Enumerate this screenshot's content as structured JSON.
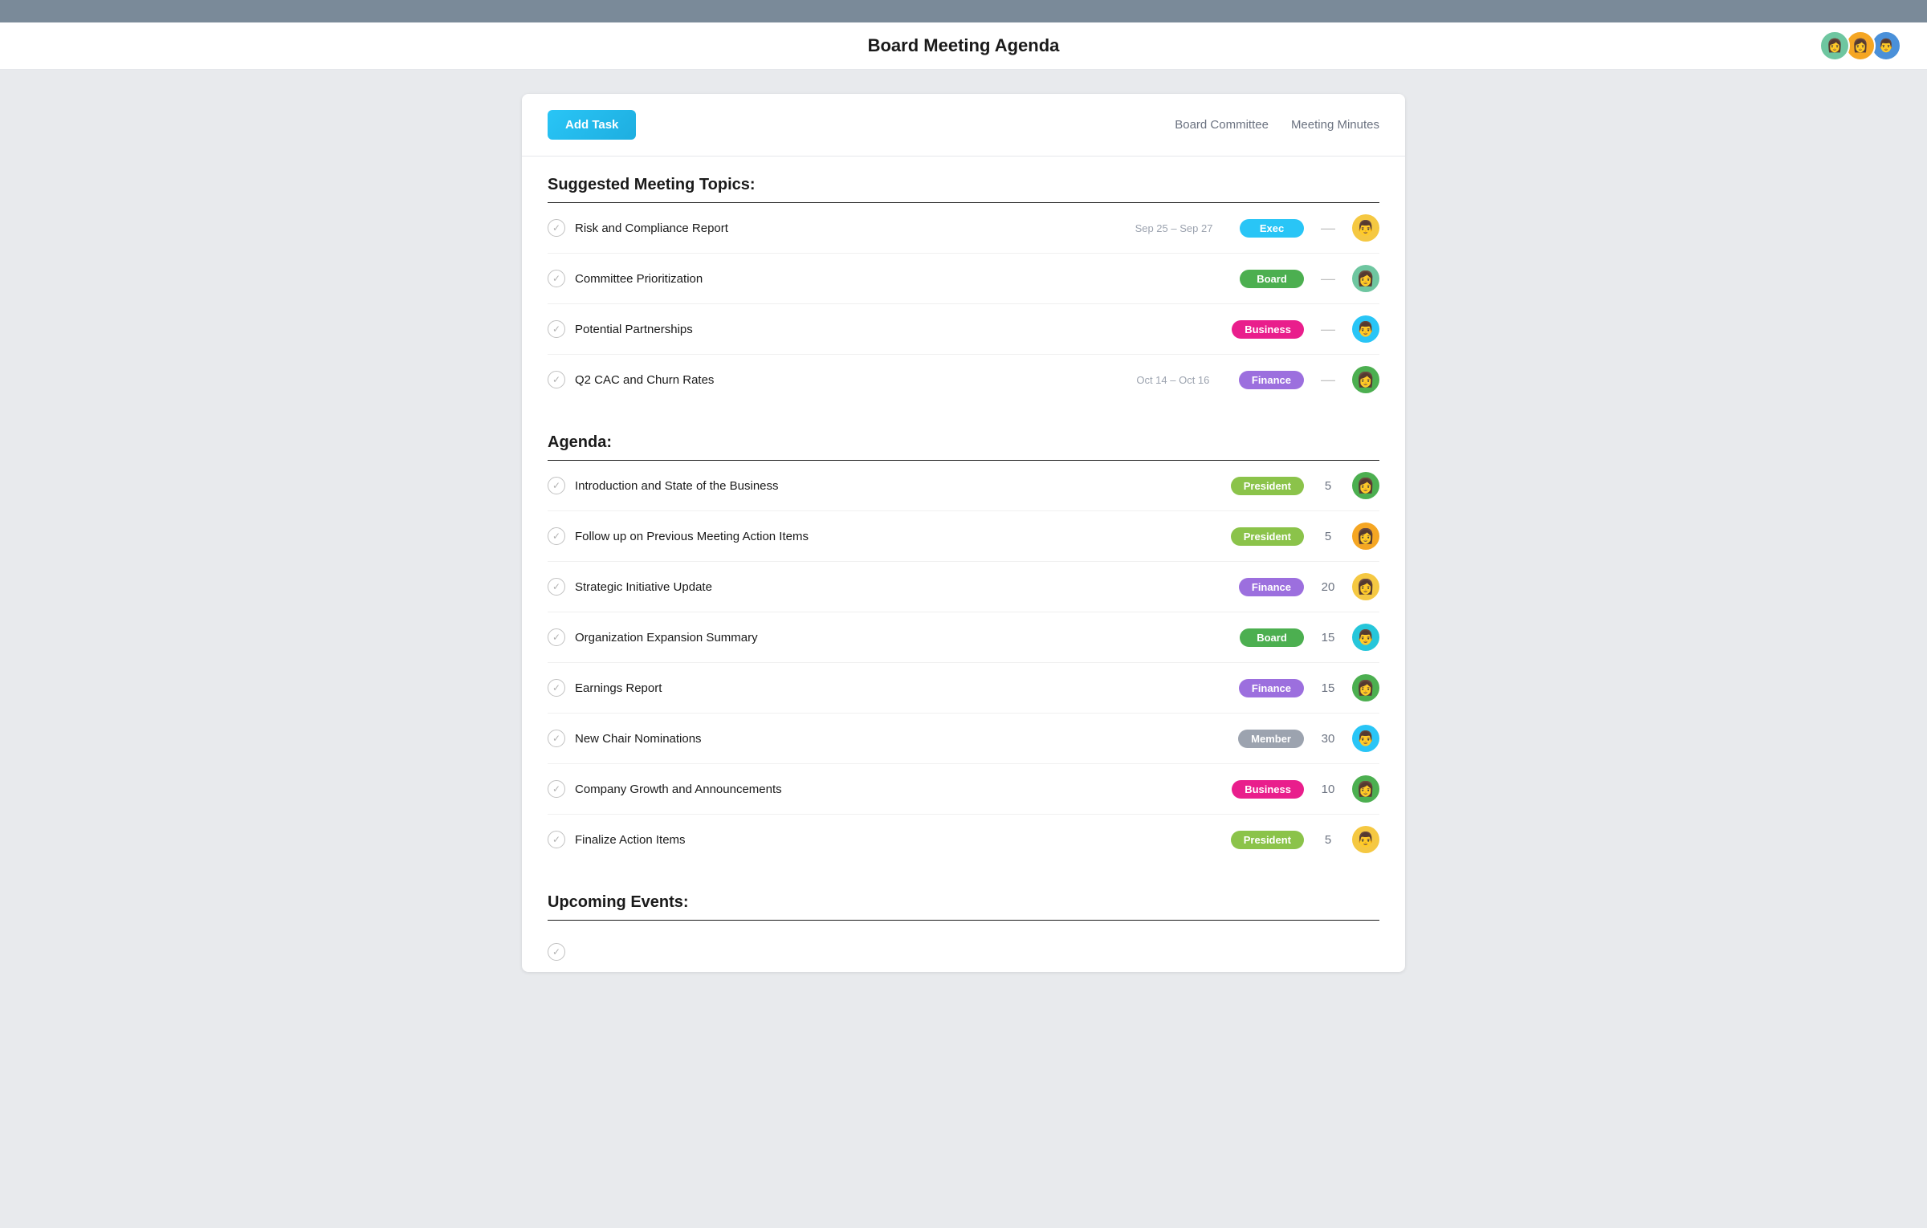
{
  "topbar": {},
  "header": {
    "title": "Board Meeting Agenda",
    "avatars": [
      {
        "color": "#6ec6a0",
        "emoji": "👩"
      },
      {
        "color": "#f5a623",
        "emoji": "👩"
      },
      {
        "color": "#4a90d9",
        "emoji": "👨"
      }
    ]
  },
  "toolbar": {
    "add_task_label": "Add Task",
    "links": [
      {
        "label": "Board Committee"
      },
      {
        "label": "Meeting Minutes"
      }
    ]
  },
  "suggested_section": {
    "title": "Suggested Meeting Topics:",
    "tasks": [
      {
        "name": "Risk and Compliance Report",
        "date": "Sep 25 – Sep 27",
        "tag": "Exec",
        "tag_class": "tag-exec",
        "duration": "",
        "show_dash": true,
        "avatar_emoji": "👨",
        "avatar_class": "av-yellow"
      },
      {
        "name": "Committee Prioritization",
        "date": "",
        "tag": "Board",
        "tag_class": "tag-board",
        "duration": "",
        "show_dash": true,
        "avatar_emoji": "👩",
        "avatar_class": "av-green"
      },
      {
        "name": "Potential Partnerships",
        "date": "",
        "tag": "Business",
        "tag_class": "tag-business",
        "duration": "",
        "show_dash": true,
        "avatar_emoji": "👨",
        "avatar_class": "av-blue"
      },
      {
        "name": "Q2 CAC and Churn Rates",
        "date": "Oct 14 – Oct 16",
        "tag": "Finance",
        "tag_class": "tag-finance",
        "duration": "",
        "show_dash": true,
        "avatar_emoji": "👩",
        "avatar_class": "av-darkgreen"
      }
    ]
  },
  "agenda_section": {
    "title": "Agenda:",
    "tasks": [
      {
        "name": "Introduction and State of the Business",
        "date": "",
        "tag": "President",
        "tag_class": "tag-president",
        "duration": "5",
        "show_dash": false,
        "avatar_emoji": "👩",
        "avatar_class": "av-darkgreen"
      },
      {
        "name": "Follow up on Previous Meeting Action Items",
        "date": "",
        "tag": "President",
        "tag_class": "tag-president",
        "duration": "5",
        "show_dash": false,
        "avatar_emoji": "👩",
        "avatar_class": "av-orange"
      },
      {
        "name": "Strategic Initiative Update",
        "date": "",
        "tag": "Finance",
        "tag_class": "tag-finance",
        "duration": "20",
        "show_dash": false,
        "avatar_emoji": "👩",
        "avatar_class": "av-yellow"
      },
      {
        "name": "Organization Expansion Summary",
        "date": "",
        "tag": "Board",
        "tag_class": "tag-board",
        "duration": "15",
        "show_dash": false,
        "avatar_emoji": "👨",
        "avatar_class": "av-teal"
      },
      {
        "name": "Earnings Report",
        "date": "",
        "tag": "Finance",
        "tag_class": "tag-finance",
        "duration": "15",
        "show_dash": false,
        "avatar_emoji": "👩",
        "avatar_class": "av-darkgreen"
      },
      {
        "name": "New Chair Nominations",
        "date": "",
        "tag": "Member",
        "tag_class": "tag-member",
        "duration": "30",
        "show_dash": false,
        "avatar_emoji": "👨",
        "avatar_class": "av-blue"
      },
      {
        "name": "Company Growth and Announcements",
        "date": "",
        "tag": "Business",
        "tag_class": "tag-business",
        "duration": "10",
        "show_dash": false,
        "avatar_emoji": "👩",
        "avatar_class": "av-darkgreen"
      },
      {
        "name": "Finalize Action Items",
        "date": "",
        "tag": "President",
        "tag_class": "tag-president",
        "duration": "5",
        "show_dash": false,
        "avatar_emoji": "👨",
        "avatar_class": "av-yellow"
      }
    ]
  },
  "upcoming_section": {
    "title": "Upcoming Events:"
  }
}
